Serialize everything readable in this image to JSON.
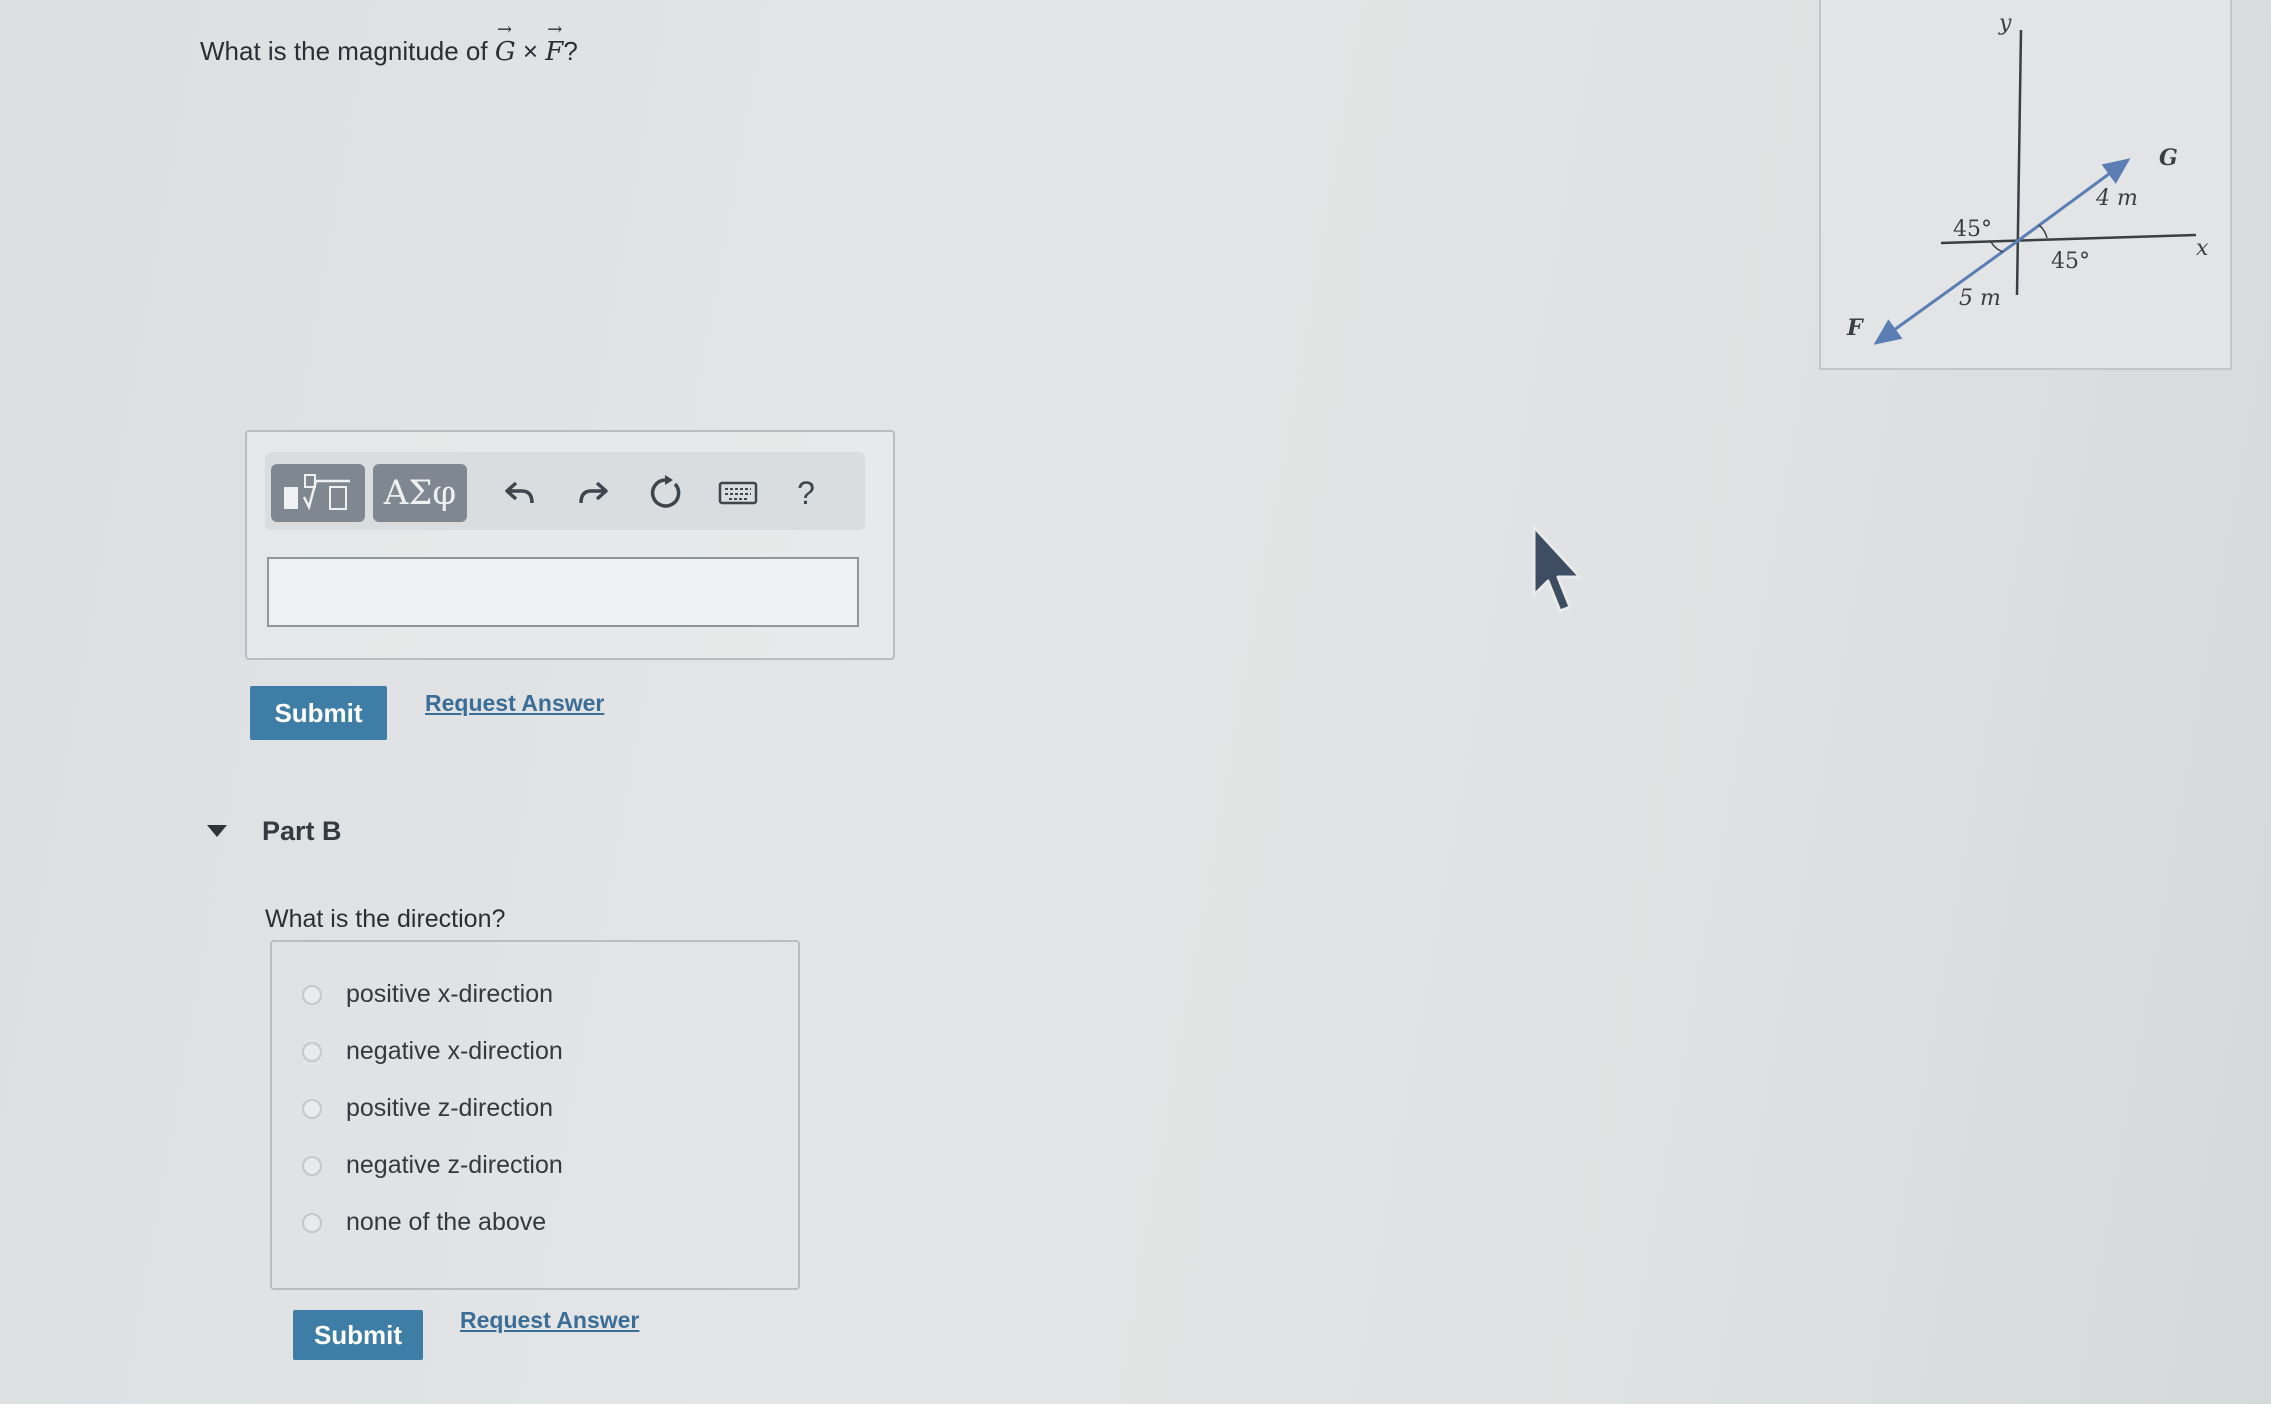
{
  "part_a": {
    "question_prefix": "What is the magnitude of",
    "vector_1": "G",
    "operator": "×",
    "vector_2": "F",
    "question_suffix": "?",
    "toolbar": {
      "greek_label": "ΑΣφ",
      "help_label": "?"
    },
    "submit_label": "Submit",
    "request_answer_label": "Request Answer"
  },
  "part_b": {
    "title": "Part B",
    "question": "What is the direction?",
    "options": [
      "positive x-direction",
      "negative x-direction",
      "positive z-direction",
      "negative z-direction",
      "none of the above"
    ],
    "submit_label": "Submit",
    "request_answer_label": "Request Answer"
  },
  "figure": {
    "y_axis_label": "y",
    "x_axis_label": "x",
    "vector_g_label": "G",
    "vector_f_label": "F",
    "g_magnitude": "4 m",
    "f_magnitude": "5 m",
    "angle_upper": "45°",
    "angle_lower": "45°"
  },
  "colors": {
    "submit_bg": "#3e7ea6",
    "link": "#3b6e97",
    "vector": "#5b7fb5",
    "toolbar_button": "#7f8891"
  }
}
